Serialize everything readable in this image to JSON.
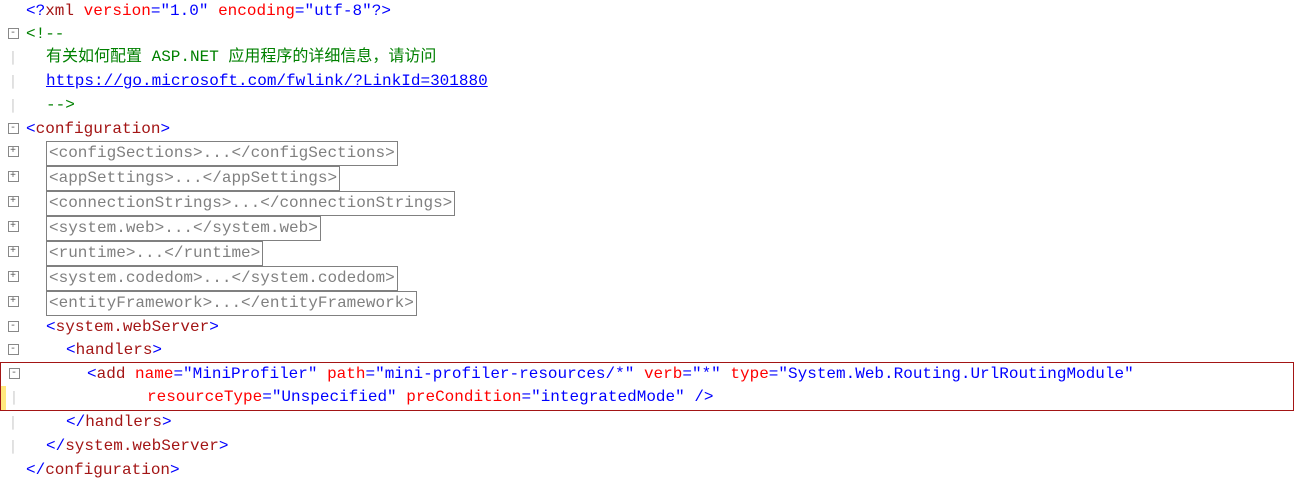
{
  "xmlDecl": {
    "lt": "<?",
    "tag": "xml",
    "a1": "version",
    "v1": "\"1.0\"",
    "a2": "encoding",
    "v2": "\"utf-8\"",
    "gt": "?>"
  },
  "comment": {
    "open": "<!--",
    "text": "有关如何配置 ASP.NET 应用程序的详细信息，请访问",
    "link": "https://go.microsoft.com/fwlink/?LinkId=301880",
    "close": "-->"
  },
  "configOpen": {
    "lt": "<",
    "tag": "configuration",
    "gt": ">"
  },
  "collapsed": [
    {
      "open": "<configSections>",
      "dots": "...",
      "close": "</configSections>"
    },
    {
      "open": "<appSettings>",
      "dots": "...",
      "close": "</appSettings>"
    },
    {
      "open": "<connectionStrings>",
      "dots": "...",
      "close": "</connectionStrings>"
    },
    {
      "open": "<system.web>",
      "dots": "...",
      "close": "</system.web>"
    },
    {
      "open": "<runtime>",
      "dots": "...",
      "close": "</runtime>"
    },
    {
      "open": "<system.codedom>",
      "dots": "...",
      "close": "</system.codedom>"
    },
    {
      "open": "<entityFramework>",
      "dots": "...",
      "close": "</entityFramework>"
    }
  ],
  "webServer": {
    "openLt": "<",
    "openTag": "system.webServer",
    "openGt": ">",
    "closeLt": "</",
    "closeTag": "system.webServer",
    "closeGt": ">"
  },
  "handlers": {
    "openLt": "<",
    "openTag": "handlers",
    "openGt": ">",
    "closeLt": "</",
    "closeTag": "handlers",
    "closeGt": ">"
  },
  "add": {
    "lt": "<",
    "tag": "add",
    "a1": "name",
    "v1": "\"MiniProfiler\"",
    "a2": "path",
    "v2": "\"mini-profiler-resources/*\"",
    "a3": "verb",
    "v3": "\"*\"",
    "a4": "type",
    "v4": "\"System.Web.Routing.UrlRoutingModule\"",
    "a5": "resourceType",
    "v5": "\"Unspecified\"",
    "a6": "preCondition",
    "v6": "\"integratedMode\"",
    "gt": " />"
  },
  "configClose": {
    "lt": "</",
    "tag": "configuration",
    "gt": ">"
  },
  "glyph": {
    "minus": "-",
    "plus": "+",
    "bar": "│"
  }
}
